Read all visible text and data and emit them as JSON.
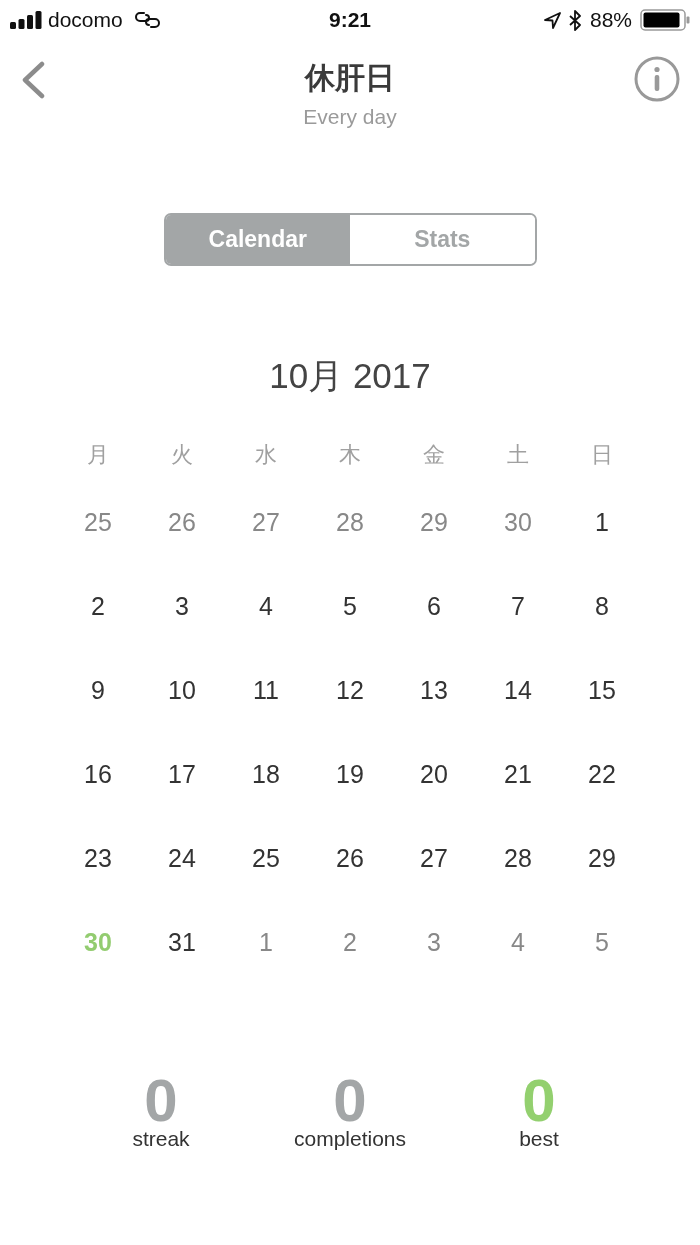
{
  "status_bar": {
    "carrier": "docomo",
    "time": "9:21",
    "battery": "88%"
  },
  "header": {
    "title": "休肝日",
    "subtitle": "Every day"
  },
  "tabs": [
    {
      "label": "Calendar",
      "selected": true
    },
    {
      "label": "Stats",
      "selected": false
    }
  ],
  "calendar": {
    "month": "10月 2017",
    "weekdays": [
      "月",
      "火",
      "水",
      "木",
      "金",
      "土",
      "日"
    ],
    "weeks": [
      [
        {
          "day": "25",
          "kind": "outside"
        },
        {
          "day": "26",
          "kind": "outside"
        },
        {
          "day": "27",
          "kind": "outside"
        },
        {
          "day": "28",
          "kind": "outside"
        },
        {
          "day": "29",
          "kind": "outside"
        },
        {
          "day": "30",
          "kind": "outside"
        },
        {
          "day": "1",
          "kind": "day"
        }
      ],
      [
        {
          "day": "2",
          "kind": "day"
        },
        {
          "day": "3",
          "kind": "day"
        },
        {
          "day": "4",
          "kind": "day"
        },
        {
          "day": "5",
          "kind": "day"
        },
        {
          "day": "6",
          "kind": "day"
        },
        {
          "day": "7",
          "kind": "day"
        },
        {
          "day": "8",
          "kind": "day"
        }
      ],
      [
        {
          "day": "9",
          "kind": "day"
        },
        {
          "day": "10",
          "kind": "day"
        },
        {
          "day": "11",
          "kind": "day"
        },
        {
          "day": "12",
          "kind": "day"
        },
        {
          "day": "13",
          "kind": "day"
        },
        {
          "day": "14",
          "kind": "day"
        },
        {
          "day": "15",
          "kind": "day"
        }
      ],
      [
        {
          "day": "16",
          "kind": "day"
        },
        {
          "day": "17",
          "kind": "day"
        },
        {
          "day": "18",
          "kind": "day"
        },
        {
          "day": "19",
          "kind": "day"
        },
        {
          "day": "20",
          "kind": "day"
        },
        {
          "day": "21",
          "kind": "day"
        },
        {
          "day": "22",
          "kind": "day"
        }
      ],
      [
        {
          "day": "23",
          "kind": "day"
        },
        {
          "day": "24",
          "kind": "day"
        },
        {
          "day": "25",
          "kind": "day"
        },
        {
          "day": "26",
          "kind": "day"
        },
        {
          "day": "27",
          "kind": "day"
        },
        {
          "day": "28",
          "kind": "day"
        },
        {
          "day": "29",
          "kind": "day"
        }
      ],
      [
        {
          "day": "30",
          "kind": "today"
        },
        {
          "day": "31",
          "kind": "day"
        },
        {
          "day": "1",
          "kind": "outside"
        },
        {
          "day": "2",
          "kind": "outside"
        },
        {
          "day": "3",
          "kind": "outside"
        },
        {
          "day": "4",
          "kind": "outside"
        },
        {
          "day": "5",
          "kind": "outside"
        }
      ]
    ]
  },
  "stats": [
    {
      "value": "0",
      "label": "streak",
      "color": "#a3a6a7"
    },
    {
      "value": "0",
      "label": "completions",
      "color": "#a3a6a7"
    },
    {
      "value": "0",
      "label": "best",
      "color": "#93d06f"
    }
  ]
}
